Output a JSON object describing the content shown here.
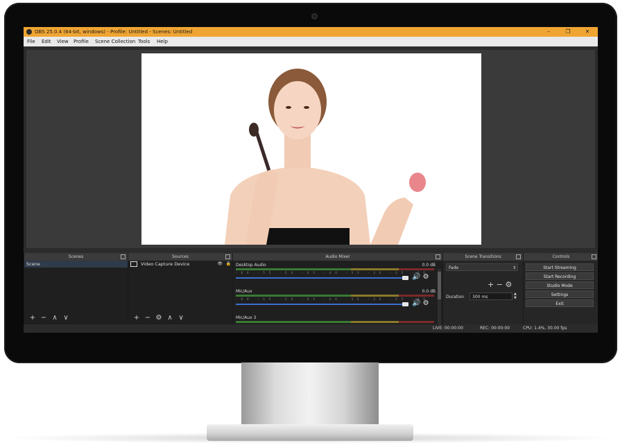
{
  "window": {
    "title": "OBS 25.0.4 (64-bit, windows) - Profile: Untitled - Scenes: Untitled",
    "controls": [
      "–",
      "❐",
      "✕"
    ]
  },
  "menu": [
    "File",
    "Edit",
    "View",
    "Profile",
    "Scene Collection",
    "Tools",
    "Help"
  ],
  "docks": {
    "scenes": {
      "header": "Scenes",
      "items": [
        "Scene"
      ]
    },
    "sources": {
      "header": "Sources",
      "items": [
        "Video Capture Device"
      ]
    },
    "mixer": {
      "header": "Audio Mixer",
      "tracks": [
        {
          "name": "Desktop Audio",
          "db": "0.0 dB"
        },
        {
          "name": "Mic/Aux",
          "db": "0.0 dB"
        },
        {
          "name": "Mic/Aux 3",
          "db": ""
        }
      ],
      "scale": "-60 -55 -50 -45 -40 -35 -30 -25 -20 -15 -10 -5 0"
    },
    "transitions": {
      "header": "Scene Transitions",
      "selected": "Fade",
      "duration_label": "Duration",
      "duration_value": "300 ms"
    },
    "controls": {
      "header": "Controls",
      "buttons": [
        "Start Streaming",
        "Start Recording",
        "Studio Mode",
        "Settings",
        "Exit"
      ]
    }
  },
  "status": {
    "live": "LIVE: 00:00:00",
    "rec": "REC: 00:00:00",
    "cpu": "CPU: 1.4%, 30.00 fps"
  },
  "icons": {
    "add": "+",
    "remove": "−",
    "up": "∧",
    "down": "∨",
    "gear": "⚙",
    "speaker": "🔊",
    "eye": "👁",
    "lock": "🔒"
  },
  "colors": {
    "titlebar": "#f0a532",
    "accent_fader": "#3c6fd1",
    "background": "#2b2b2b"
  }
}
